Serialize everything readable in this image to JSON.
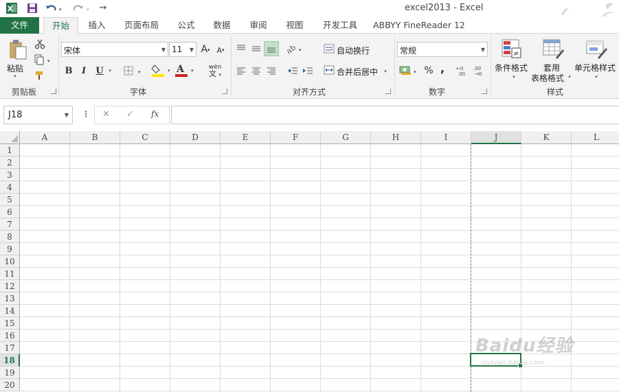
{
  "window": {
    "title": "excel2013 - Excel"
  },
  "quick_access": {
    "icons": [
      "excel-logo-icon",
      "save-icon",
      "undo-icon",
      "redo-icon",
      "customize-icon"
    ]
  },
  "tabs": [
    {
      "label": "文件"
    },
    {
      "label": "开始"
    },
    {
      "label": "插入"
    },
    {
      "label": "页面布局"
    },
    {
      "label": "公式"
    },
    {
      "label": "数据"
    },
    {
      "label": "审阅"
    },
    {
      "label": "视图"
    },
    {
      "label": "开发工具"
    },
    {
      "label": "ABBYY FineReader 12"
    }
  ],
  "ribbon": {
    "clipboard": {
      "paste_label": "粘贴",
      "group_label": "剪贴板"
    },
    "font": {
      "name": "宋体",
      "size": "11",
      "phonetic_label": "wén",
      "bold": "B",
      "italic": "I",
      "underline": "U",
      "grow": "A",
      "shrink": "A",
      "group_label": "字体",
      "fill_color": "#FFE600",
      "font_color": "#D02020"
    },
    "alignment": {
      "wrap_label": "自动换行",
      "merge_label": "合并后居中",
      "group_label": "对齐方式"
    },
    "number": {
      "format": "常规",
      "percent": "%",
      "comma": ",",
      "group_label": "数字"
    },
    "styles": {
      "conditional_label": "条件格式",
      "table_label_1": "套用",
      "table_label_2": "表格格式",
      "cell_label": "单元格样式",
      "group_label": "样式"
    }
  },
  "formula_bar": {
    "name_box": "J18",
    "fx_label": "fx",
    "cancel": "✕",
    "enter": "✓",
    "formula": ""
  },
  "sheet": {
    "columns": [
      "A",
      "B",
      "C",
      "D",
      "E",
      "F",
      "G",
      "H",
      "I",
      "J",
      "K",
      "L"
    ],
    "rows": [
      "1",
      "2",
      "3",
      "4",
      "5",
      "6",
      "7",
      "8",
      "9",
      "10",
      "11",
      "12",
      "13",
      "14",
      "15",
      "16",
      "17",
      "18",
      "19",
      "20"
    ],
    "selected_column": "J",
    "selected_row": "18"
  },
  "watermark": {
    "text": "Baidu经验",
    "sub": "jingyan.baidu.com"
  },
  "colors": {
    "accent": "#217346"
  }
}
